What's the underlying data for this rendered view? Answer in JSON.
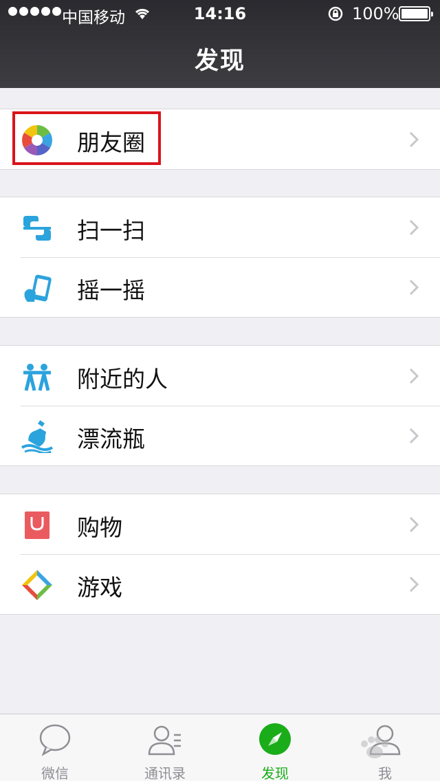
{
  "status_bar": {
    "carrier": "中国移动",
    "time": "14:16",
    "battery": "100%"
  },
  "nav": {
    "title": "发现"
  },
  "groups": [
    {
      "items": [
        {
          "label": "朋友圈",
          "icon": "moments-icon"
        }
      ]
    },
    {
      "items": [
        {
          "label": "扫一扫",
          "icon": "scan-icon"
        },
        {
          "label": "摇一摇",
          "icon": "shake-icon"
        }
      ]
    },
    {
      "items": [
        {
          "label": "附近的人",
          "icon": "nearby-people-icon"
        },
        {
          "label": "漂流瓶",
          "icon": "drift-bottle-icon"
        }
      ]
    },
    {
      "items": [
        {
          "label": "购物",
          "icon": "shopping-icon"
        },
        {
          "label": "游戏",
          "icon": "games-icon"
        }
      ]
    }
  ],
  "tabs": [
    {
      "label": "微信",
      "icon": "chat-bubble-icon",
      "active": false
    },
    {
      "label": "通讯录",
      "icon": "contacts-icon",
      "active": false
    },
    {
      "label": "发现",
      "icon": "compass-icon",
      "active": true
    },
    {
      "label": "我",
      "icon": "person-icon",
      "active": false
    }
  ],
  "colors": {
    "accent": "#1aad19",
    "highlight_box": "#d9141b",
    "nav_background": "#2a2a2f",
    "page_background": "#efeff4"
  }
}
